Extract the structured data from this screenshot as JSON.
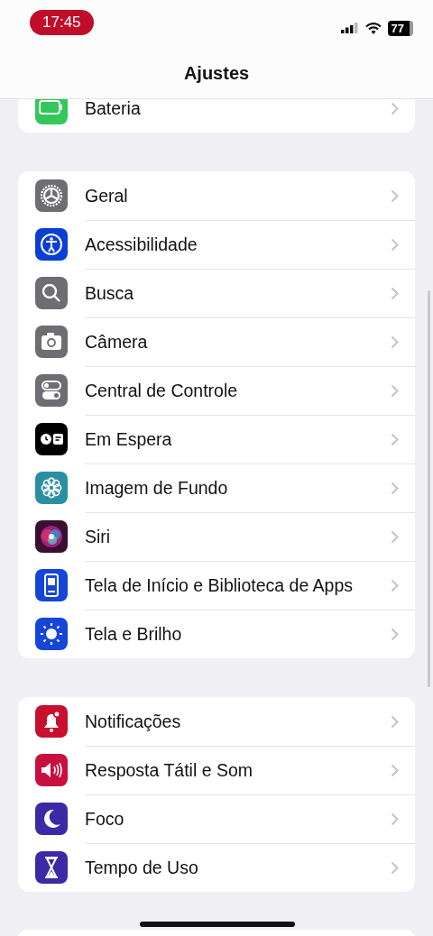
{
  "status_bar": {
    "time": "17:45",
    "battery": "77"
  },
  "header": {
    "title": "Ajustes"
  },
  "sections": [
    {
      "partial": true,
      "rows": [
        {
          "label": "Bateria",
          "kind": "battery",
          "color": "#34c759"
        }
      ]
    },
    {
      "partial": false,
      "rows": [
        {
          "label": "Geral",
          "kind": "gear",
          "color": "#6d6d72"
        },
        {
          "label": "Acessibilidade",
          "kind": "accessibility",
          "color": "#0a3fd6"
        },
        {
          "label": "Busca",
          "kind": "search",
          "color": "#6d6d72"
        },
        {
          "label": "Câmera",
          "kind": "camera",
          "color": "#6d6d72"
        },
        {
          "label": "Central de Controle",
          "kind": "toggles",
          "color": "#6d6d72"
        },
        {
          "label": "Em Espera",
          "kind": "standby",
          "color": "#000000"
        },
        {
          "label": "Imagem de Fundo",
          "kind": "flower",
          "color": "#2b8fa3"
        },
        {
          "label": "Siri",
          "kind": "siri",
          "color": "#3a1030"
        },
        {
          "label": "Tela de Início e Biblioteca de Apps",
          "kind": "phone",
          "color": "#1546d8"
        },
        {
          "label": "Tela e Brilho",
          "kind": "sun",
          "color": "#1546d8"
        }
      ]
    },
    {
      "partial": false,
      "rows": [
        {
          "label": "Notificações",
          "kind": "bell",
          "color": "#c8102e"
        },
        {
          "label": "Resposta Tátil e Som",
          "kind": "speaker",
          "color": "#c8103e"
        },
        {
          "label": "Foco",
          "kind": "moon",
          "color": "#3b2aa6"
        },
        {
          "label": "Tempo de Uso",
          "kind": "hourglass",
          "color": "#3b2aa6"
        }
      ]
    }
  ]
}
